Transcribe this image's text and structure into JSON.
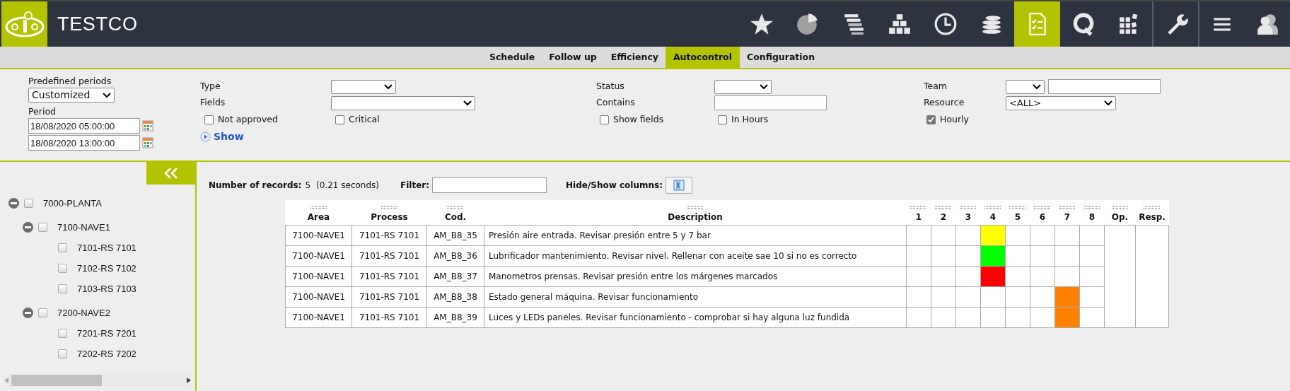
{
  "app": {
    "title": "TESTCO"
  },
  "toolbar": [
    {
      "selected": false
    },
    {
      "selected": false
    },
    {
      "selected": false
    },
    {
      "selected": false
    },
    {
      "selected": false
    },
    {
      "selected": false
    },
    {
      "selected": true
    },
    {
      "selected": false
    },
    {
      "selected": false
    },
    {
      "selected": false
    },
    {
      "selected": false
    },
    {
      "selected": false
    }
  ],
  "tabs": [
    {
      "label": "Schedule",
      "selected": false
    },
    {
      "label": "Follow up",
      "selected": false
    },
    {
      "label": "Efficiency",
      "selected": false
    },
    {
      "label": "Autocontrol",
      "selected": true
    },
    {
      "label": "Configuration",
      "selected": false
    }
  ],
  "filters": {
    "predefined_periods": {
      "label": "Predefined periods",
      "value": "Customized"
    },
    "period": {
      "label": "Period",
      "from": "18/08/2020 05:00:00",
      "to": "18/08/2020 13:00:00"
    },
    "type": {
      "label": "Type"
    },
    "fields": {
      "label": "Fields"
    },
    "status": {
      "label": "Status"
    },
    "contains": {
      "label": "Contains"
    },
    "team": {
      "label": "Team"
    },
    "resource": {
      "label": "Resource",
      "value": "<ALL>"
    },
    "checkboxes": [
      {
        "label": "Not approved",
        "checked": false
      },
      {
        "label": "Critical",
        "checked": false
      },
      {
        "label": "Show fields",
        "checked": false
      },
      {
        "label": "In Hours",
        "checked": false
      },
      {
        "label": "Hourly",
        "checked": true
      }
    ],
    "show_link": "Show"
  },
  "tree": [
    {
      "label": "7000-PLANTA",
      "expanded": true,
      "checked": false,
      "children": [
        {
          "label": "7100-NAVE1",
          "expanded": true,
          "checked": false,
          "children": [
            {
              "label": "7101-RS 7101",
              "checked": false
            },
            {
              "label": "7102-RS 7102",
              "checked": false
            },
            {
              "label": "7103-RS 7103",
              "checked": false
            }
          ]
        },
        {
          "label": "7200-NAVE2",
          "expanded": true,
          "checked": false,
          "children": [
            {
              "label": "7201-RS 7201",
              "checked": false
            },
            {
              "label": "7202-RS 7202",
              "checked": false
            }
          ]
        }
      ]
    }
  ],
  "summary": {
    "records_label": "Number of records:",
    "records": "5",
    "time": "(0.21 seconds)",
    "filter_label": "Filter:",
    "columns_label": "Hide/Show columns:"
  },
  "table": {
    "columns": [
      "Area",
      "Process",
      "Cod.",
      "Description",
      "1",
      "2",
      "3",
      "4",
      "5",
      "6",
      "7",
      "8",
      "Op.",
      "Resp."
    ],
    "rows": [
      {
        "area": "7100-NAVE1",
        "process": "7101-RS 7101",
        "code": "AM_B8_35",
        "description": "Presión aire entrada. Revisar presión entre 5 y 7 bar",
        "slots": [
          {
            "filled": false
          },
          {
            "filled": false
          },
          {
            "filled": false
          },
          {
            "filled": true,
            "color": "#ffff00"
          },
          {
            "filled": false
          },
          {
            "filled": false
          },
          {
            "filled": false
          },
          {
            "filled": false
          }
        ]
      },
      {
        "area": "7100-NAVE1",
        "process": "7101-RS 7101",
        "code": "AM_B8_36",
        "description": "Lubrificador mantenimiento. Revisar nivel. Rellenar con aceite sae 10 si no es correcto",
        "slots": [
          {
            "filled": false
          },
          {
            "filled": false
          },
          {
            "filled": false
          },
          {
            "filled": true,
            "color": "#00ff00"
          },
          {
            "filled": false
          },
          {
            "filled": false
          },
          {
            "filled": false
          },
          {
            "filled": false
          }
        ]
      },
      {
        "area": "7100-NAVE1",
        "process": "7101-RS 7101",
        "code": "AM_B8_37",
        "description": "Manometros prensas. Revisar presión entre los márgenes marcados",
        "slots": [
          {
            "filled": false
          },
          {
            "filled": false
          },
          {
            "filled": false
          },
          {
            "filled": true,
            "color": "#ff0000"
          },
          {
            "filled": false
          },
          {
            "filled": false
          },
          {
            "filled": false
          },
          {
            "filled": false
          }
        ]
      },
      {
        "area": "7100-NAVE1",
        "process": "7101-RS 7101",
        "code": "AM_B8_38",
        "description": "Estado general máquina. Revisar funcionamiento",
        "slots": [
          {
            "filled": false
          },
          {
            "filled": false
          },
          {
            "filled": false
          },
          {
            "filled": false
          },
          {
            "filled": false
          },
          {
            "filled": false
          },
          {
            "filled": true,
            "color": "#ff8000"
          },
          {
            "filled": false
          }
        ]
      },
      {
        "area": "7100-NAVE1",
        "process": "7101-RS 7101",
        "code": "AM_B8_39",
        "description": "Luces y LEDs paneles. Revisar funcionamiento - comprobar si hay alguna luz fundida",
        "slots": [
          {
            "filled": false
          },
          {
            "filled": false
          },
          {
            "filled": false
          },
          {
            "filled": false
          },
          {
            "filled": false
          },
          {
            "filled": false
          },
          {
            "filled": true,
            "color": "#ff8000"
          },
          {
            "filled": false
          }
        ]
      }
    ]
  }
}
